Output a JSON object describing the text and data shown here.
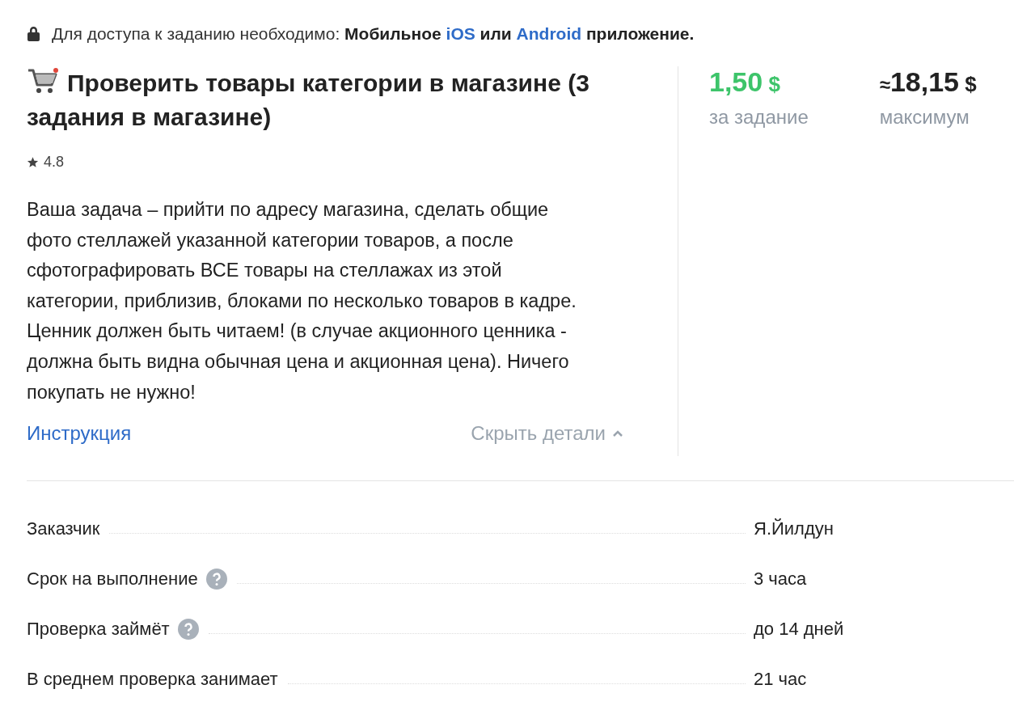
{
  "notice": {
    "segments": [
      {
        "kind": "plain",
        "text": "Для доступа к заданию необходимо: "
      },
      {
        "kind": "bold",
        "text": "Мобильное "
      },
      {
        "kind": "link",
        "text": "iOS"
      },
      {
        "kind": "bold",
        "text": " или "
      },
      {
        "kind": "link",
        "text": "Android"
      },
      {
        "kind": "bold",
        "text": " приложение."
      }
    ]
  },
  "task": {
    "title": "Проверить товары категории в магазине (3 задания в магазине)",
    "rating": "4.8",
    "description": "Ваша задача – прийти по адресу магазина, сделать общие фото стеллажей указанной категории товаров, а после сфотографировать ВСЕ товары на стеллажах из этой категории, приблизив, блоками по несколько товаров в кадре.  Ценник должен быть читаем! (в случае акционного ценника - должна быть видна обычная цена и акционная цена). Ничего покупать не нужно!",
    "instruction_link": "Инструкция",
    "toggle": {
      "label": "Скрыть детали",
      "expanded": true
    }
  },
  "prices": [
    {
      "kind": "reward",
      "amount": "1,50",
      "currency": "$",
      "caption": "за задание"
    },
    {
      "kind": "max",
      "prefix": "≈",
      "amount": "18,15",
      "currency": "$",
      "caption": "максимум"
    }
  ],
  "details": [
    {
      "label": "Заказчик",
      "has_help": false,
      "value": "Я.Йилдун"
    },
    {
      "label": "Срок на выполнение",
      "has_help": true,
      "value": "3 часа"
    },
    {
      "label": "Проверка займёт",
      "has_help": true,
      "value": "до 14 дней"
    },
    {
      "label": "В среднем проверка занимает",
      "has_help": false,
      "value": "21 час"
    }
  ]
}
